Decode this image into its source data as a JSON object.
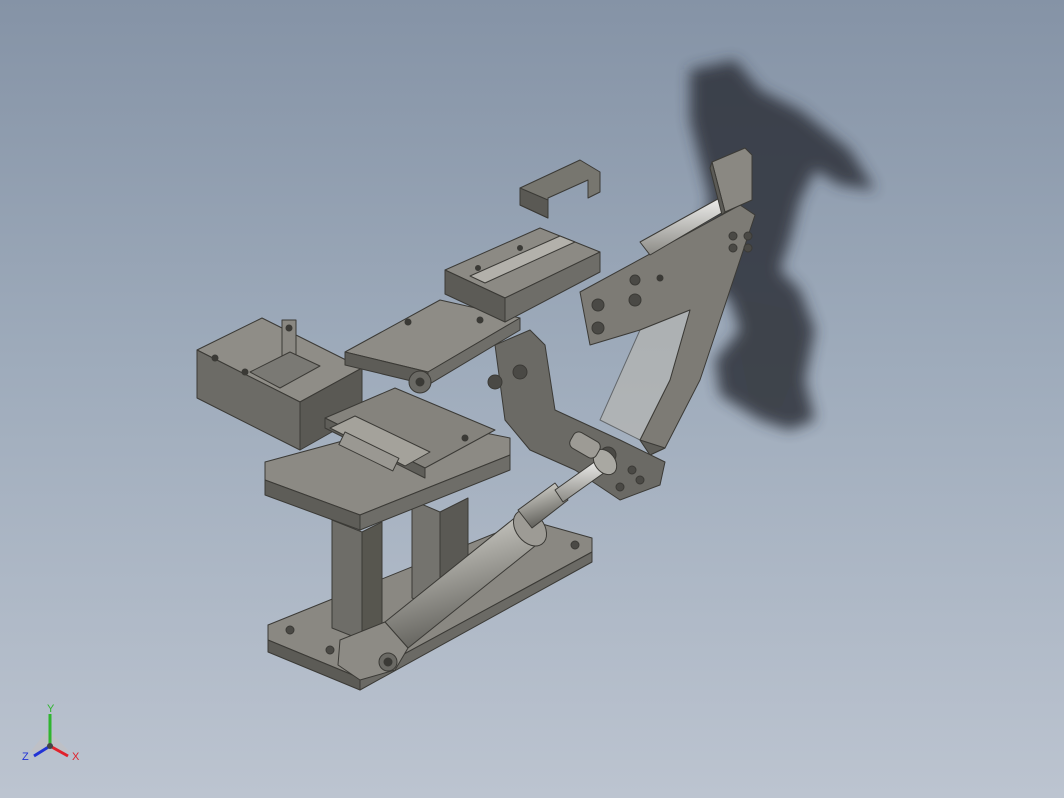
{
  "view": {
    "background_top": "#8593a6",
    "background_bottom": "#bcc4d0",
    "part_color": "#7f7d77",
    "part_dark": "#55544f",
    "part_light": "#a5a39c",
    "shadow_color": "#2d323a"
  },
  "model": {
    "components": [
      "base-plate",
      "support-column",
      "left-clamp-block",
      "center-slide-table",
      "upper-guide-rail",
      "u-bracket",
      "curved-arm",
      "pneumatic-cylinder",
      "pivot-link"
    ]
  },
  "triad": {
    "x_label": "X",
    "y_label": "Y",
    "z_label": "Z",
    "x_color": "#e0212b",
    "y_color": "#2fb52f",
    "z_color": "#2133d6"
  }
}
